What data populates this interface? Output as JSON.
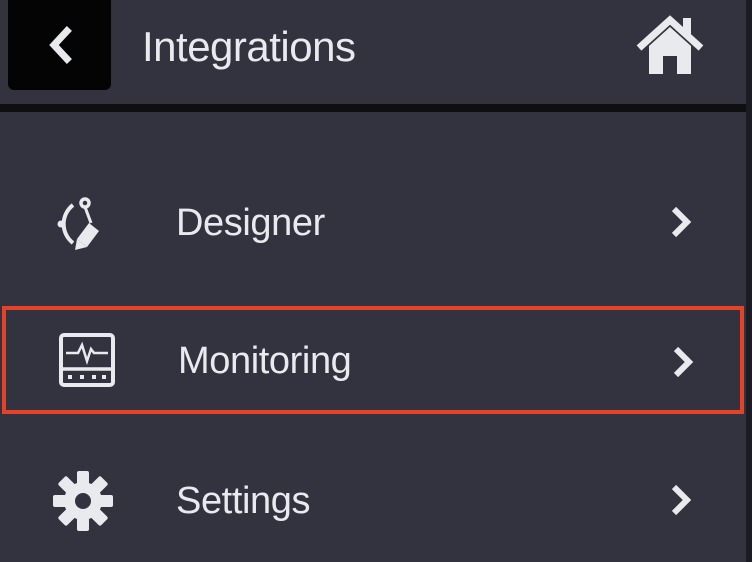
{
  "header": {
    "title": "Integrations",
    "back_icon": "chevron-left-icon",
    "home_icon": "home-icon"
  },
  "menu": {
    "items": [
      {
        "label": "Designer",
        "icon": "designer-pen-icon",
        "highlighted": false
      },
      {
        "label": "Monitoring",
        "icon": "monitor-pulse-icon",
        "highlighted": true
      },
      {
        "label": "Settings",
        "icon": "gear-icon",
        "highlighted": false
      }
    ]
  },
  "colors": {
    "background": "#32333f",
    "text": "#e9eaee",
    "highlight_border": "#e4432a",
    "back_button": "#040405"
  }
}
